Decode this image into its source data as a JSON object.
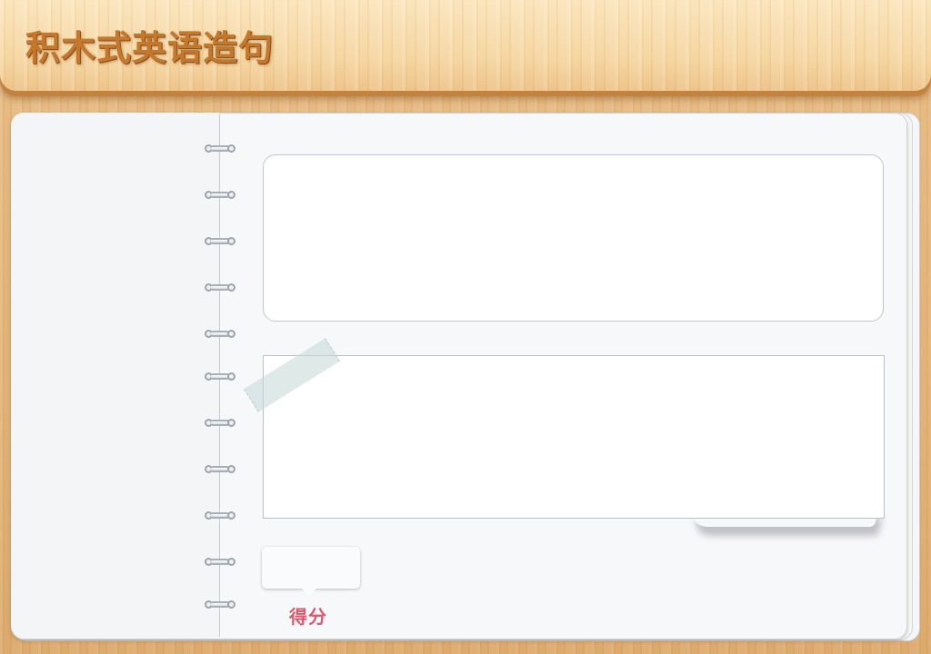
{
  "header": {
    "title": "积木式英语造句"
  },
  "notebook": {
    "ring_count": 11
  },
  "sentence_panel": {
    "text": ""
  },
  "block_panel": {
    "blocks": []
  },
  "score": {
    "label": "得分",
    "value": ""
  },
  "colors": {
    "title": "#c4782c",
    "score_label": "#e0556a",
    "wood": "#e2b276"
  }
}
